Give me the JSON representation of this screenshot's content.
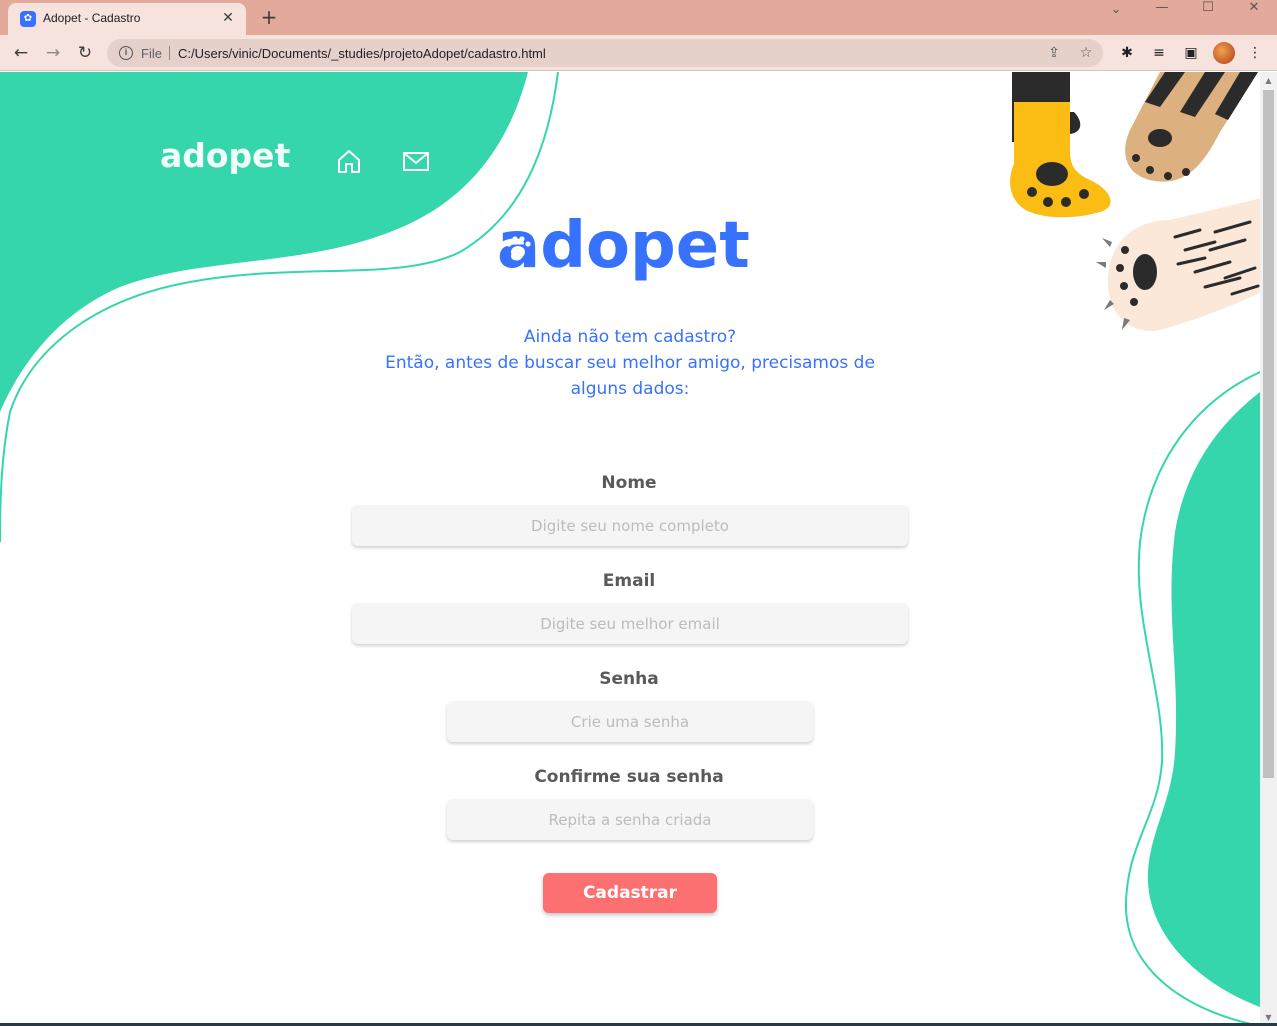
{
  "browser": {
    "tab_title": "Adopet - Cadastro",
    "tab_close": "✕",
    "new_tab": "+",
    "url_scheme_label": "File",
    "url": "C:/Users/vinic/Documents/_studies/projetoAdopet/cadastro.html",
    "window_controls": {
      "collapse": "⌄",
      "minimize": "—",
      "maximize": "☐",
      "close": "✕"
    },
    "nav": {
      "back": "←",
      "forward": "→",
      "reload": "↻"
    },
    "toolbar_icons": {
      "info": "i",
      "share": "⇪",
      "bookmark": "☆",
      "extensions": "✱",
      "media": "≡",
      "sidepanel": "▣",
      "menu": "⋮"
    }
  },
  "page": {
    "brand_header": "adopet",
    "brand_main": "adopet",
    "intro_line1": "Ainda não tem cadastro?",
    "intro_line2": "Então, antes de buscar seu melhor amigo, precisamos de",
    "intro_line3": "alguns dados:",
    "fields": {
      "nome": {
        "label": "Nome",
        "placeholder": "Digite seu nome completo"
      },
      "email": {
        "label": "Email",
        "placeholder": "Digite seu melhor email"
      },
      "senha": {
        "label": "Senha",
        "placeholder": "Crie uma senha"
      },
      "confirmar": {
        "label": "Confirme sua senha",
        "placeholder": "Repita a senha criada"
      }
    },
    "submit_label": "Cadastrar"
  },
  "colors": {
    "accent_green": "#36d6ad",
    "brand_blue": "#3772ff",
    "button_coral": "#fc7071",
    "chrome_tab_strip": "#e3aa9b",
    "chrome_toolbar": "#f6e3de"
  },
  "icons": [
    "adopet-favicon-icon",
    "info-icon",
    "share-icon",
    "star-icon",
    "extensions-icon",
    "media-icon",
    "side-panel-icon",
    "menu-icon",
    "home-icon",
    "mail-icon",
    "paw-icon"
  ]
}
